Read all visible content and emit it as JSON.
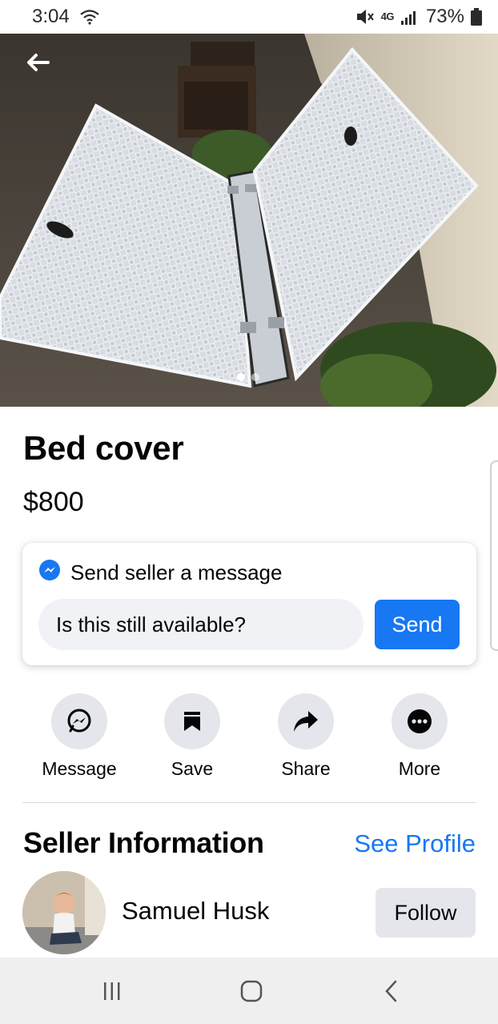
{
  "status_bar": {
    "time": "3:04",
    "network": "4G",
    "battery": "73%"
  },
  "listing": {
    "title": "Bed cover",
    "price": "$800",
    "photo_count": 2,
    "photo_index": 1
  },
  "message_card": {
    "heading": "Send seller a message",
    "input_value": "Is this still available?",
    "send_label": "Send"
  },
  "actions": [
    {
      "label": "Message",
      "icon": "messenger-icon"
    },
    {
      "label": "Save",
      "icon": "bookmark-icon"
    },
    {
      "label": "Share",
      "icon": "share-icon"
    },
    {
      "label": "More",
      "icon": "more-icon"
    }
  ],
  "seller": {
    "section_title": "Seller Information",
    "see_profile": "See Profile",
    "name": "Samuel Husk",
    "follow_label": "Follow"
  },
  "colors": {
    "accent": "#1877f2",
    "button_gray": "#e4e6eb",
    "input_bg": "#f0f2f5"
  }
}
